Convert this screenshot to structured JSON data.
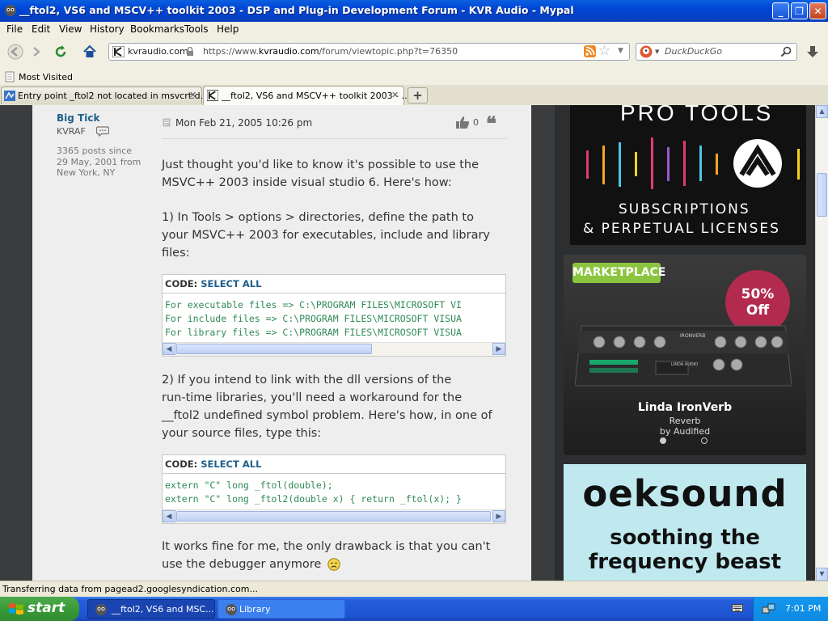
{
  "window": {
    "title": "__ftol2, VS6 and MSCV++ toolkit 2003 - DSP and Plug-in Development Forum - KVR Audio - Mypal"
  },
  "menu": [
    "File",
    "Edit",
    "View",
    "History",
    "Bookmarks",
    "Tools",
    "Help"
  ],
  "nav": {
    "identity": "kvraudio.com",
    "url_prefix": "https://www.",
    "url_domain": "kvraudio.com",
    "url_path": "/forum/viewtopic.php?t=76350",
    "search_placeholder": "DuckDuckGo"
  },
  "bookmarks": {
    "most_visited": "Most Visited"
  },
  "tabs": [
    {
      "label": "Entry point _ftol2 not located in msvcrt.d...",
      "active": false
    },
    {
      "label": "__ftol2, VS6 and MSCV++ toolkit 2003 - ...",
      "active": true
    }
  ],
  "post": {
    "author": "Big Tick",
    "rank": "KVRAF",
    "stats_line1": "3365 posts since",
    "stats_line2": "29 May, 2001 from",
    "stats_line3": "New York, NY",
    "date": "Mon Feb 21, 2005 10:26 pm",
    "likes": "0",
    "para1_l1": "Just thought you'd like to know it's possible to use the",
    "para1_l2": "MSVC++ 2003 inside visual studio 6. Here's how:",
    "para2_l1": "1) In Tools > options > directories, define the path to",
    "para2_l2": "your MSVC++ 2003 for executables, include and library",
    "para2_l3": "files:",
    "code_label": "CODE:",
    "select_all": "SELECT ALL",
    "code1": [
      "For executable files => C:\\PROGRAM FILES\\MICROSOFT VI",
      "For include files => C:\\PROGRAM FILES\\MICROSOFT VISUA",
      "For library files => C:\\PROGRAM FILES\\MICROSOFT VISUA"
    ],
    "para3_l1": "2) If you intend to link with the dll versions of the",
    "para3_l2": "run-time libraries, you'll need a workaround for the",
    "para3_l3": "__ftol2 undefined symbol problem. Here's how, in one of",
    "para3_l4": "your source files, type this:",
    "code2": [
      "extern \"C\" long _ftol(double);",
      "extern \"C\" long _ftol2(double x) { return _ftol(x); }"
    ],
    "para4_l1": "It works fine for me, the only drawback is that you can't",
    "para4_l2": "use the debugger anymore"
  },
  "ads": {
    "ad1_title": "PRO TOOLS",
    "ad1_line1": "SUBSCRIPTIONS",
    "ad1_line2": "& PERPETUAL LICENSES",
    "ad2_badge": "MARKETPLACE",
    "ad2_discount1": "50%",
    "ad2_discount2": "Off",
    "ad2_product_label": "IRONVERB",
    "ad2_brand_label": "LINDA AUDIO",
    "ad2_name": "Linda IronVerb",
    "ad2_type": "Reverb",
    "ad2_by": "by Audified",
    "ad3_brand": "oeksound",
    "ad3_line1": "soothing the",
    "ad3_line2": "frequency beast"
  },
  "status": "Transferring data from pagead2.googlesyndication.com...",
  "taskbar": {
    "start": "start",
    "items": [
      "__ftol2, VS6 and MSC...",
      "Library"
    ],
    "clock": "7:01 PM"
  },
  "colors": {
    "xp_blue": "#0046d5",
    "start_green": "#3a9a38",
    "link_blue": "#1d5f8b",
    "code_green": "#2e8b57",
    "discount_red": "#b22a4e",
    "marketplace_green": "#8bc53f"
  }
}
